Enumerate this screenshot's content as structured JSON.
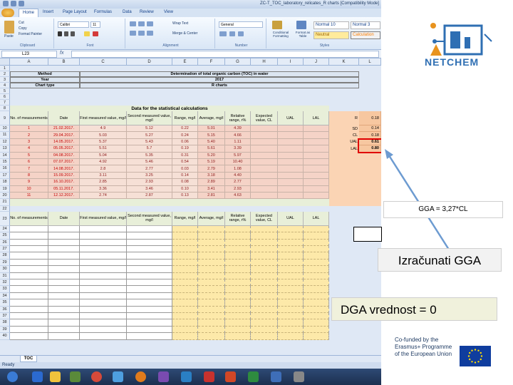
{
  "window": {
    "title": "ZC-T_TOC_laboratory_relicates_R charts [Compatibility Mode]",
    "tabs": [
      "Home",
      "Insert",
      "Page Layout",
      "Formulas",
      "Data",
      "Review",
      "View"
    ]
  },
  "ribbon": {
    "clipboard": {
      "paste": "Paste",
      "cut": "Cut",
      "copy": "Copy",
      "format_painter": "Format Painter",
      "name": "Clipboard"
    },
    "font": {
      "family": "Calibri",
      "size": "11",
      "name": "Font"
    },
    "alignment": {
      "wrap": "Wrap Text",
      "merge": "Merge & Center",
      "name": "Alignment"
    },
    "number": {
      "format": "General",
      "name": "Number"
    },
    "styles": {
      "conditional": "Conditional Formatting",
      "format_table": "Format as Table",
      "normal10": "Normal 10",
      "normal3": "Normal 3",
      "neutral": "Neutral",
      "calculation": "Calculation",
      "name": "Styles"
    }
  },
  "formula_bar": {
    "cell_ref": "L23",
    "fx": "fx"
  },
  "columns": [
    "A",
    "B",
    "C",
    "D",
    "E",
    "F",
    "G",
    "H",
    "I",
    "J",
    "K",
    "L"
  ],
  "info_rows": [
    {
      "label": "Method",
      "value": "Determination of total organic carbon (TOC) in water"
    },
    {
      "label": "Year",
      "value": "2017"
    },
    {
      "label": "Chart type",
      "value": "R charts"
    }
  ],
  "section_title": "Data for the statistical calculations",
  "table_headers": [
    "No. of measurements",
    "Date",
    "First measured value, mg/l",
    "Second measured value, mg/l",
    "Range, mg/l",
    "Average, mg/l",
    "Relative range, r%",
    "Expected value, CL",
    "UAL",
    "LAL"
  ],
  "table_headers2": [
    "No. of measurements",
    "Date",
    "First measured value, mg/l",
    "Second measured value, mg/l",
    "Range, mg/l",
    "Average, mg/l",
    "Relative range, r%",
    "Expected value, CL",
    "UAL",
    "LAL"
  ],
  "data_rows": [
    [
      "1",
      "21.02.2017.",
      "4.9",
      "5.12",
      "0.22",
      "5.01",
      "4.39"
    ],
    [
      "2",
      "29.04.2017.",
      "5.03",
      "5.27",
      "0.24",
      "5.15",
      "4.66"
    ],
    [
      "3",
      "14.05.2017.",
      "5.37",
      "5.43",
      "0.06",
      "5.40",
      "1.11"
    ],
    [
      "4",
      "05.05.2017.",
      "5.51",
      "5.7",
      "0.19",
      "5.61",
      "3.39"
    ],
    [
      "5",
      "04.08.2017.",
      "5.04",
      "5.35",
      "0.31",
      "5.20",
      "5.97"
    ],
    [
      "6",
      "07.07.2017.",
      "4.92",
      "5.46",
      "0.54",
      "5.19",
      "10.40"
    ],
    [
      "7",
      "14.08.2017.",
      "2.8",
      "2.77",
      "0.03",
      "2.79",
      "1.08"
    ],
    [
      "8",
      "15.09.2017.",
      "3.11",
      "3.25",
      "0.14",
      "3.18",
      "4.40"
    ],
    [
      "9",
      "16.10.2017.",
      "2.85",
      "2.93",
      "0.08",
      "2.89",
      "2.77"
    ],
    [
      "10",
      "05.11.2017.",
      "3.36",
      "3.46",
      "0.10",
      "3.41",
      "2.93"
    ],
    [
      "11",
      "12.12.2017.",
      "2.74",
      "2.87",
      "0.13",
      "2.81",
      "4.63"
    ]
  ],
  "stats": [
    {
      "label": "R",
      "value": "0.18"
    },
    {
      "label": "SD",
      "value": "0.14"
    },
    {
      "label": "CL",
      "value": "0.18"
    },
    {
      "label": "UAL",
      "value": "0.61"
    },
    {
      "label": "LAL",
      "value": "0.80"
    }
  ],
  "row_numbers": [
    "1",
    "2",
    "3",
    "4",
    "5",
    "6",
    "7",
    "8",
    "9",
    "10",
    "11",
    "12",
    "13",
    "14",
    "15",
    "16",
    "17",
    "18",
    "19",
    "20",
    "21",
    "22",
    "23",
    "24",
    "25",
    "26",
    "27",
    "28",
    "29",
    "30",
    "31",
    "32",
    "33",
    "34",
    "35",
    "36",
    "37",
    "38",
    "39",
    "40"
  ],
  "sheet_tab": "TOC",
  "status": "Ready",
  "annotations": {
    "gga_formula": "GGA = 3,27*CL",
    "calculate": "Izračunati GGA",
    "dga": "DGA vrednost = 0"
  },
  "logo_text": "NETCHEM",
  "eu_text": [
    "Co-funded by the",
    "Erasmus+ Programme",
    "of the European Union"
  ],
  "colors": {
    "salmon": "#f5d3c7",
    "pale": "#e8efd9",
    "yellow": "#fde9a9",
    "orange_stats": "#fbd4b4",
    "highlight": "#e00000",
    "arrow": "#6d9bd1"
  }
}
